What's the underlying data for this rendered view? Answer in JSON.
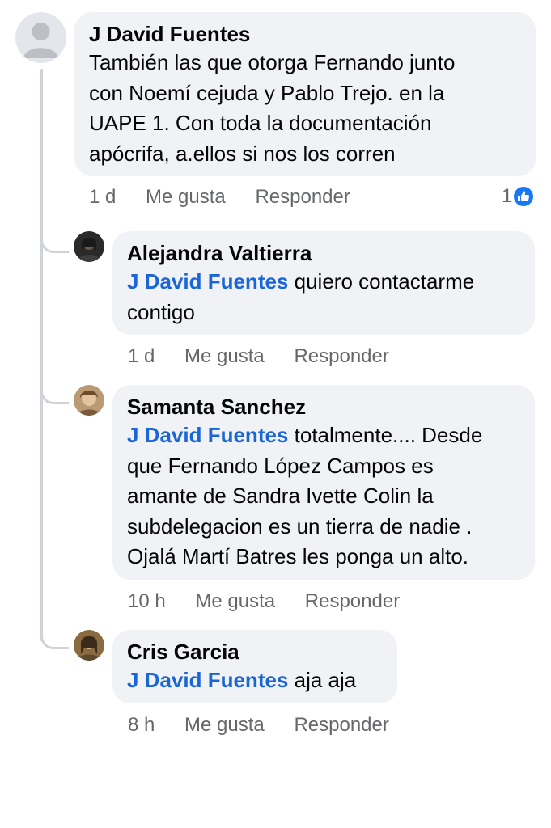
{
  "comments": [
    {
      "author": "J David Fuentes",
      "lines": [
        "También las que otorga Fernando junto",
        "con Noemí cejuda y Pablo Trejo. en la",
        "UAPE 1. Con toda la documentación",
        "apócrifa, a.ellos si nos los corren"
      ],
      "time": "1 d",
      "like_label": "Me gusta",
      "reply_label": "Responder",
      "reaction_count": "1"
    }
  ],
  "replies": [
    {
      "author": "Alejandra Valtierra",
      "mention": "J David Fuentes",
      "first_line_rest": " quiero contactarme",
      "lines": [
        "contigo"
      ],
      "time": "1 d",
      "like_label": "Me gusta",
      "reply_label": "Responder"
    },
    {
      "author": "Samanta Sanchez",
      "mention": "J David Fuentes",
      "first_line_rest": " totalmente.... Desde",
      "lines": [
        "que Fernando López Campos es",
        "amante de Sandra Ivette Colin la",
        "subdelegacion es un tierra de nadie .",
        "Ojalá Martí Batres  les ponga un alto."
      ],
      "time": "10 h",
      "like_label": "Me gusta",
      "reply_label": "Responder"
    },
    {
      "author": "Cris Garcia",
      "mention": "J David Fuentes",
      "first_line_rest": " aja aja",
      "lines": [],
      "time": "8 h",
      "like_label": "Me gusta",
      "reply_label": "Responder"
    }
  ],
  "colors": {
    "mention": "#1a66d8",
    "bubble": "#f0f2f5",
    "meta": "#65676b",
    "like_badge": "#1877f2"
  },
  "icons": {
    "reaction": "like-thumbs-up-icon",
    "avatar_default": "default-person-icon"
  }
}
